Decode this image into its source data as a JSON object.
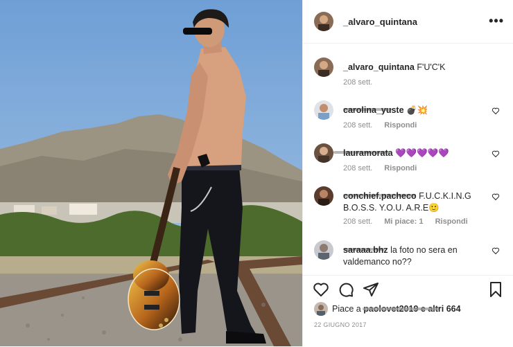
{
  "post": {
    "username": "_alvaro_quintana",
    "caption": "F'U'C'K",
    "caption_time": "208 sett.",
    "more_label": "•••"
  },
  "comments": [
    {
      "username": "carolina_yuste",
      "text": "💣💥",
      "time": "208 sett.",
      "reply": "Rispondi",
      "likes": ""
    },
    {
      "username": "lauramorata",
      "text": "💜💜💜💜💜",
      "time": "208 sett.",
      "reply": "Rispondi",
      "likes": ""
    },
    {
      "username": "conchief.pacheco",
      "text": "F.U.C.K.I.N.G B.O.S.S. Y.O.U. A.R.E🙂",
      "time": "208 sett.",
      "reply": "Rispondi",
      "likes": "Mi piace: 1"
    },
    {
      "username": "saraaa.bhz",
      "text": "la foto no sera en valdemanco no??",
      "time": "",
      "reply": "",
      "likes": ""
    }
  ],
  "likes_line": {
    "prefix": "Piace a",
    "user": "paolovet2019",
    "suffix": "e altri 664"
  },
  "date": "22 GIUGNO 2017",
  "icons": [
    "more-icon",
    "heart-icon",
    "comment-icon",
    "share-icon",
    "bookmark-icon"
  ],
  "colors": {
    "sky": "#7ea8d6",
    "text": "#262626",
    "meta": "#8e8e8e",
    "border": "#efefef"
  }
}
